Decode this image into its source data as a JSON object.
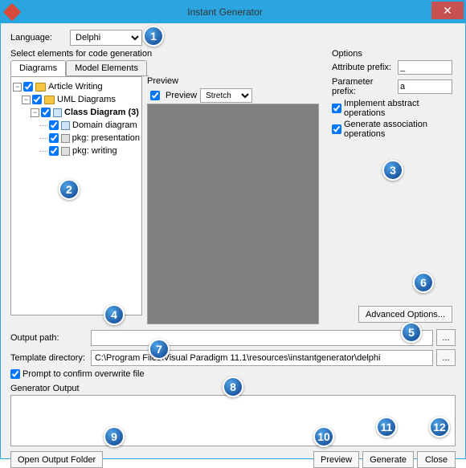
{
  "window": {
    "title": "Instant Generator"
  },
  "language": {
    "label": "Language:",
    "value": "Delphi"
  },
  "select_elements_label": "Select elements for code generation",
  "tabs": {
    "diagrams": "Diagrams",
    "model_elements": "Model Elements"
  },
  "tree": {
    "article_writing": "Article Writing",
    "uml_diagrams": "UML Diagrams",
    "class_diagram": "Class Diagram (3)",
    "domain_diagram": "Domain diagram",
    "pkg_presentation": "pkg: presentation",
    "pkg_writing": "pkg: writing"
  },
  "preview": {
    "label": "Preview",
    "checkbox": "Preview",
    "stretch": "Stretch"
  },
  "options": {
    "label": "Options",
    "attr_prefix_label": "Attribute prefix:",
    "attr_prefix_value": "_",
    "param_prefix_label": "Parameter prefix:",
    "param_prefix_value": "a",
    "impl_abstract": "Implement abstract operations",
    "gen_assoc": "Generate association operations",
    "advanced": "Advanced Options..."
  },
  "paths": {
    "output_label": "Output path:",
    "output_value": "",
    "template_label": "Template directory:",
    "template_value": "C:\\Program Files\\Visual Paradigm 11.1\\resources\\instantgenerator\\delphi",
    "browse": "...",
    "prompt_overwrite": "Prompt to confirm overwrite file"
  },
  "generator_output_label": "Generator Output",
  "buttons": {
    "open_output": "Open Output Folder",
    "preview": "Preview",
    "generate": "Generate",
    "close": "Close"
  },
  "annotations": [
    "1",
    "2",
    "3",
    "4",
    "5",
    "6",
    "7",
    "8",
    "9",
    "10",
    "11",
    "12"
  ]
}
